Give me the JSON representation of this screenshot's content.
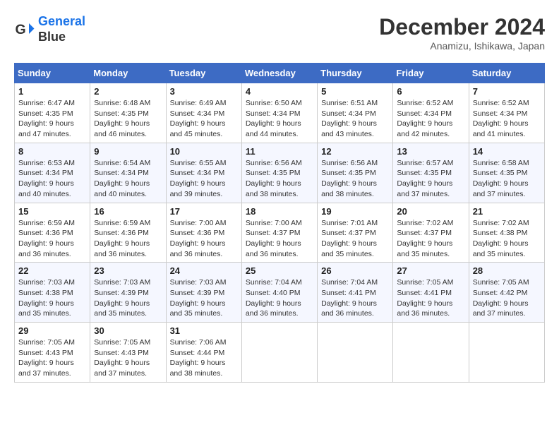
{
  "header": {
    "logo_line1": "General",
    "logo_line2": "Blue",
    "month": "December 2024",
    "location": "Anamizu, Ishikawa, Japan"
  },
  "weekdays": [
    "Sunday",
    "Monday",
    "Tuesday",
    "Wednesday",
    "Thursday",
    "Friday",
    "Saturday"
  ],
  "weeks": [
    [
      {
        "day": "1",
        "info": "Sunrise: 6:47 AM\nSunset: 4:35 PM\nDaylight: 9 hours\nand 47 minutes."
      },
      {
        "day": "2",
        "info": "Sunrise: 6:48 AM\nSunset: 4:35 PM\nDaylight: 9 hours\nand 46 minutes."
      },
      {
        "day": "3",
        "info": "Sunrise: 6:49 AM\nSunset: 4:34 PM\nDaylight: 9 hours\nand 45 minutes."
      },
      {
        "day": "4",
        "info": "Sunrise: 6:50 AM\nSunset: 4:34 PM\nDaylight: 9 hours\nand 44 minutes."
      },
      {
        "day": "5",
        "info": "Sunrise: 6:51 AM\nSunset: 4:34 PM\nDaylight: 9 hours\nand 43 minutes."
      },
      {
        "day": "6",
        "info": "Sunrise: 6:52 AM\nSunset: 4:34 PM\nDaylight: 9 hours\nand 42 minutes."
      },
      {
        "day": "7",
        "info": "Sunrise: 6:52 AM\nSunset: 4:34 PM\nDaylight: 9 hours\nand 41 minutes."
      }
    ],
    [
      {
        "day": "8",
        "info": "Sunrise: 6:53 AM\nSunset: 4:34 PM\nDaylight: 9 hours\nand 40 minutes."
      },
      {
        "day": "9",
        "info": "Sunrise: 6:54 AM\nSunset: 4:34 PM\nDaylight: 9 hours\nand 40 minutes."
      },
      {
        "day": "10",
        "info": "Sunrise: 6:55 AM\nSunset: 4:34 PM\nDaylight: 9 hours\nand 39 minutes."
      },
      {
        "day": "11",
        "info": "Sunrise: 6:56 AM\nSunset: 4:35 PM\nDaylight: 9 hours\nand 38 minutes."
      },
      {
        "day": "12",
        "info": "Sunrise: 6:56 AM\nSunset: 4:35 PM\nDaylight: 9 hours\nand 38 minutes."
      },
      {
        "day": "13",
        "info": "Sunrise: 6:57 AM\nSunset: 4:35 PM\nDaylight: 9 hours\nand 37 minutes."
      },
      {
        "day": "14",
        "info": "Sunrise: 6:58 AM\nSunset: 4:35 PM\nDaylight: 9 hours\nand 37 minutes."
      }
    ],
    [
      {
        "day": "15",
        "info": "Sunrise: 6:59 AM\nSunset: 4:36 PM\nDaylight: 9 hours\nand 36 minutes."
      },
      {
        "day": "16",
        "info": "Sunrise: 6:59 AM\nSunset: 4:36 PM\nDaylight: 9 hours\nand 36 minutes."
      },
      {
        "day": "17",
        "info": "Sunrise: 7:00 AM\nSunset: 4:36 PM\nDaylight: 9 hours\nand 36 minutes."
      },
      {
        "day": "18",
        "info": "Sunrise: 7:00 AM\nSunset: 4:37 PM\nDaylight: 9 hours\nand 36 minutes."
      },
      {
        "day": "19",
        "info": "Sunrise: 7:01 AM\nSunset: 4:37 PM\nDaylight: 9 hours\nand 35 minutes."
      },
      {
        "day": "20",
        "info": "Sunrise: 7:02 AM\nSunset: 4:37 PM\nDaylight: 9 hours\nand 35 minutes."
      },
      {
        "day": "21",
        "info": "Sunrise: 7:02 AM\nSunset: 4:38 PM\nDaylight: 9 hours\nand 35 minutes."
      }
    ],
    [
      {
        "day": "22",
        "info": "Sunrise: 7:03 AM\nSunset: 4:38 PM\nDaylight: 9 hours\nand 35 minutes."
      },
      {
        "day": "23",
        "info": "Sunrise: 7:03 AM\nSunset: 4:39 PM\nDaylight: 9 hours\nand 35 minutes."
      },
      {
        "day": "24",
        "info": "Sunrise: 7:03 AM\nSunset: 4:39 PM\nDaylight: 9 hours\nand 35 minutes."
      },
      {
        "day": "25",
        "info": "Sunrise: 7:04 AM\nSunset: 4:40 PM\nDaylight: 9 hours\nand 36 minutes."
      },
      {
        "day": "26",
        "info": "Sunrise: 7:04 AM\nSunset: 4:41 PM\nDaylight: 9 hours\nand 36 minutes."
      },
      {
        "day": "27",
        "info": "Sunrise: 7:05 AM\nSunset: 4:41 PM\nDaylight: 9 hours\nand 36 minutes."
      },
      {
        "day": "28",
        "info": "Sunrise: 7:05 AM\nSunset: 4:42 PM\nDaylight: 9 hours\nand 37 minutes."
      }
    ],
    [
      {
        "day": "29",
        "info": "Sunrise: 7:05 AM\nSunset: 4:43 PM\nDaylight: 9 hours\nand 37 minutes."
      },
      {
        "day": "30",
        "info": "Sunrise: 7:05 AM\nSunset: 4:43 PM\nDaylight: 9 hours\nand 37 minutes."
      },
      {
        "day": "31",
        "info": "Sunrise: 7:06 AM\nSunset: 4:44 PM\nDaylight: 9 hours\nand 38 minutes."
      },
      {
        "day": "",
        "info": ""
      },
      {
        "day": "",
        "info": ""
      },
      {
        "day": "",
        "info": ""
      },
      {
        "day": "",
        "info": ""
      }
    ]
  ]
}
